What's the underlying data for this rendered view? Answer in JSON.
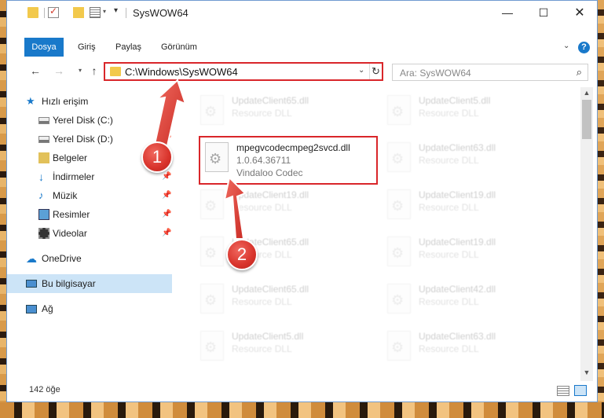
{
  "window": {
    "title": "SysWOW64",
    "controls": {
      "minimize": "—",
      "maximize": "☐",
      "close": "✕"
    }
  },
  "ribbon": {
    "tabs": [
      {
        "label": "Dosya",
        "active": true
      },
      {
        "label": "Giriş"
      },
      {
        "label": "Paylaş"
      },
      {
        "label": "Görünüm"
      }
    ],
    "help": "?"
  },
  "address": {
    "path": "C:\\Windows\\SysWOW64",
    "search_placeholder": "Ara: SysWOW64"
  },
  "sidebar": {
    "items": [
      {
        "label": "Hızlı erişim",
        "icon": "star-icon"
      },
      {
        "label": "Yerel Disk (C:)",
        "icon": "drive-icon"
      },
      {
        "label": "Yerel Disk (D:)",
        "icon": "drive-icon"
      },
      {
        "label": "Belgeler",
        "icon": "folder-icon"
      },
      {
        "label": "İndirmeler",
        "icon": "download-icon"
      },
      {
        "label": "Müzik",
        "icon": "music-icon"
      },
      {
        "label": "Resimler",
        "icon": "pictures-icon"
      },
      {
        "label": "Videolar",
        "icon": "video-icon"
      },
      {
        "label": "OneDrive",
        "icon": "cloud-icon"
      },
      {
        "label": "Bu bilgisayar",
        "icon": "computer-icon",
        "selected": true
      },
      {
        "label": "Ağ",
        "icon": "network-icon"
      }
    ]
  },
  "files": {
    "left": [
      {
        "name": "UpdateClient65.dll",
        "type": "Resource DLL"
      },
      {
        "name": "UpdateClient19.dll",
        "type": "Resource DLL"
      },
      {
        "name": "UpdateClient65.dll",
        "type": "Resource DLL"
      },
      {
        "name": "UpdateClient65.dll",
        "type": "Resource DLL"
      },
      {
        "name": "UpdateClient5.dll",
        "type": "Resource DLL"
      }
    ],
    "right": [
      {
        "name": "UpdateClient5.dll",
        "type": "Resource DLL"
      },
      {
        "name": "UpdateClient63.dll",
        "type": "Resource DLL"
      },
      {
        "name": "UpdateClient19.dll",
        "type": "Resource DLL"
      },
      {
        "name": "UpdateClient19.dll",
        "type": "Resource DLL"
      },
      {
        "name": "UpdateClient42.dll",
        "type": "Resource DLL"
      },
      {
        "name": "UpdateClient63.dll",
        "type": "Resource DLL"
      }
    ],
    "highlighted": {
      "name": "mpegvcodecmpeg2svcd.dll",
      "version": "1.0.64.36711",
      "description": "Vindaloo Codec"
    }
  },
  "status": {
    "count": "142 öğe"
  },
  "annotations": {
    "step1": "1",
    "step2": "2"
  },
  "colors": {
    "accent": "#1979ca",
    "highlight_border": "#d9262a",
    "selected": "#cce4f7"
  }
}
